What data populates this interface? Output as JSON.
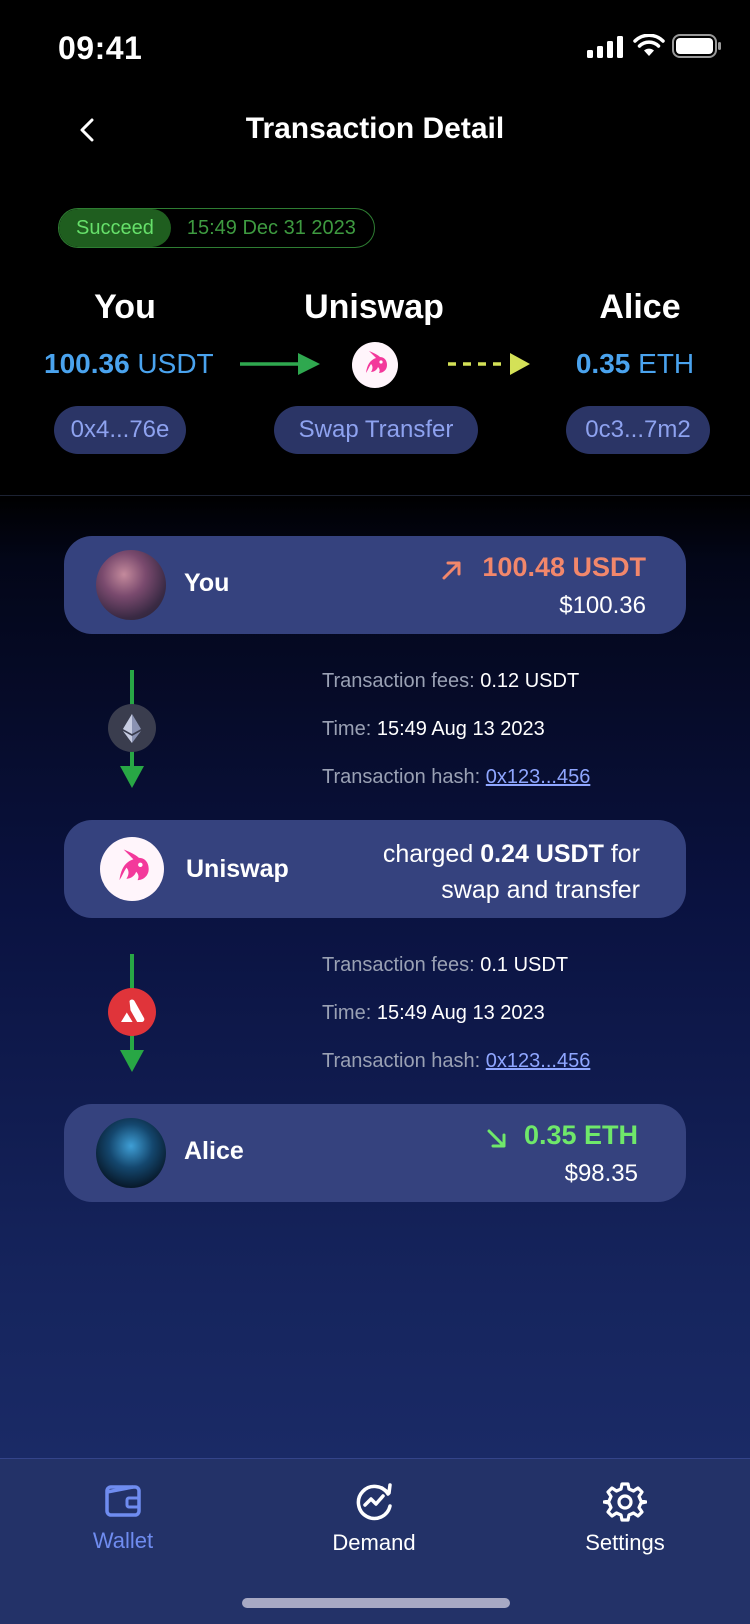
{
  "status_bar": {
    "time": "09:41"
  },
  "header": {
    "title": "Transaction Detail"
  },
  "summary": {
    "status": "Succeed",
    "date": "15:49 Dec 31 2023",
    "from": {
      "name": "You",
      "amount": "100.36",
      "unit": "USDT",
      "address": "0x4...76e"
    },
    "via": {
      "name": "Uniswap",
      "type": "Swap Transfer"
    },
    "to": {
      "name": "Alice",
      "amount": "0.35",
      "unit": "ETH",
      "address": "0c3...7m2"
    }
  },
  "flow": {
    "sender": {
      "name": "You",
      "amount": "100.48 USDT",
      "usd": "$100.36"
    },
    "leg1": {
      "fees_label": "Transaction fees:",
      "fees_value": "0.12 USDT",
      "time_label": "Time:",
      "time_value": "15:49 Aug 13 2023",
      "hash_label": "Transaction hash:",
      "hash_value": "0x123...456"
    },
    "router": {
      "name": "Uniswap",
      "text_pre": "charged",
      "charge": "0.24 USDT",
      "text_mid": "for",
      "text_post": "swap and transfer"
    },
    "leg2": {
      "fees_label": "Transaction fees:",
      "fees_value": "0.1 USDT",
      "time_label": "Time:",
      "time_value": "15:49 Aug 13 2023",
      "hash_label": "Transaction hash:",
      "hash_value": "0x123...456"
    },
    "receiver": {
      "name": "Alice",
      "amount": "0.35 ETH",
      "usd": "$98.35"
    }
  },
  "tabs": [
    {
      "label": "Wallet",
      "icon": "wallet-icon",
      "active": true
    },
    {
      "label": "Demand",
      "icon": "demand-icon",
      "active": false
    },
    {
      "label": "Settings",
      "icon": "gear-icon",
      "active": false
    }
  ],
  "colors": {
    "accent_blue": "#4aa3ee",
    "success_green": "#66e06a",
    "sent_red": "#f2876b",
    "received_green": "#6fe86a",
    "card_bg": "#35427e",
    "link": "#8fa6ff"
  }
}
